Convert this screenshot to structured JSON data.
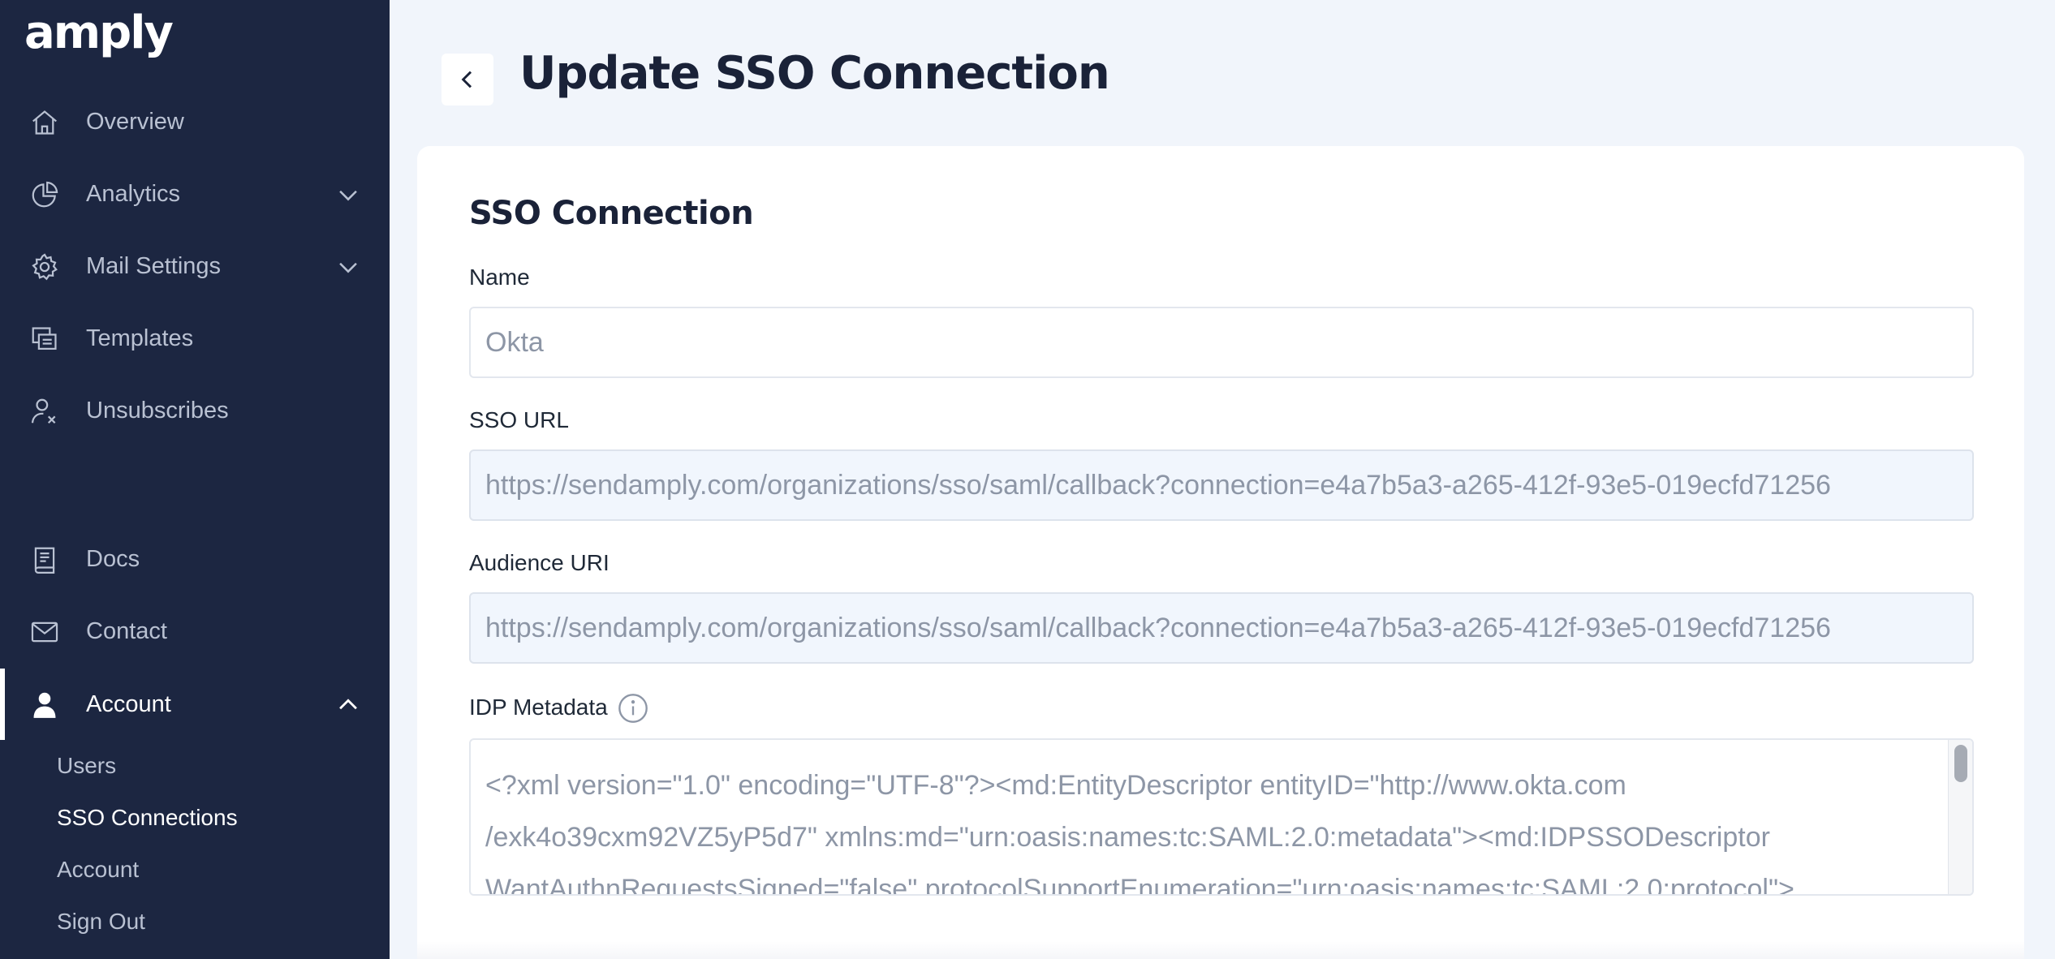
{
  "brand": {
    "logo": "amply"
  },
  "sidebar": {
    "items": [
      {
        "label": "Overview",
        "icon": "home-icon",
        "expandable": false
      },
      {
        "label": "Analytics",
        "icon": "pie-chart-icon",
        "expandable": true
      },
      {
        "label": "Mail Settings",
        "icon": "gear-icon",
        "expandable": true
      },
      {
        "label": "Templates",
        "icon": "templates-icon",
        "expandable": false
      },
      {
        "label": "Unsubscribes",
        "icon": "user-x-icon",
        "expandable": false
      },
      {
        "label": "Docs",
        "icon": "book-icon",
        "expandable": false
      },
      {
        "label": "Contact",
        "icon": "mail-icon",
        "expandable": false
      },
      {
        "label": "Account",
        "icon": "user-icon",
        "expandable": true,
        "expanded": true,
        "active": true
      }
    ],
    "sub_items": [
      {
        "label": "Users"
      },
      {
        "label": "SSO Connections",
        "current": true
      },
      {
        "label": "Account"
      },
      {
        "label": "Sign Out"
      }
    ]
  },
  "header": {
    "back_icon": "chevron-left-icon",
    "title": "Update SSO Connection"
  },
  "form": {
    "section_title": "SSO Connection",
    "name": {
      "label": "Name",
      "placeholder": "Okta"
    },
    "sso_url": {
      "label": "SSO URL",
      "value": "https://sendamply.com/organizations/sso/saml/callback?connection=e4a7b5a3-a265-412f-93e5-019ecfd71256"
    },
    "audience_uri": {
      "label": "Audience URI",
      "value": "https://sendamply.com/organizations/sso/saml/callback?connection=e4a7b5a3-a265-412f-93e5-019ecfd71256"
    },
    "idp_metadata": {
      "label": "IDP Metadata",
      "info_icon": "info-icon",
      "value": "<?xml version=\"1.0\" encoding=\"UTF-8\"?><md:EntityDescriptor entityID=\"http://www.okta.com\n/exk4o39cxm92VZ5yP5d7\" xmlns:md=\"urn:oasis:names:tc:SAML:2.0:metadata\"><md:IDPSSODescriptor\nWantAuthnRequestsSigned=\"false\" protocolSupportEnumeration=\"urn:oasis:names:tc:SAML:2.0:protocol\">"
    }
  },
  "colors": {
    "sidebar_bg": "#1c2641",
    "page_bg": "#f1f5fb",
    "title": "#1a2238",
    "readonly_field_bg": "#f1f6fd"
  }
}
